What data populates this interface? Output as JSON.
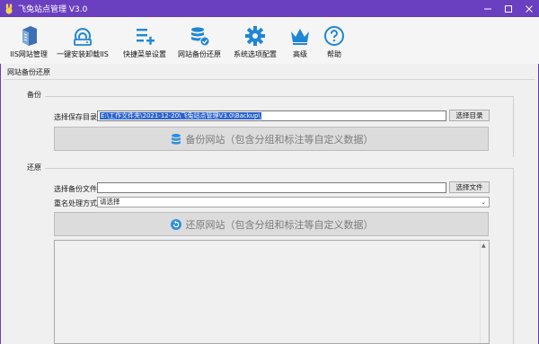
{
  "window": {
    "title": "飞兔站点管理 V3.0"
  },
  "toolbar": {
    "items": [
      {
        "label": "IIS网站管理",
        "icon": "server-icon"
      },
      {
        "label": "一键安装卸载IIS",
        "icon": "disk-drive-icon"
      },
      {
        "label": "快捷菜单设置",
        "icon": "menu-add-icon"
      },
      {
        "label": "网站备份还原",
        "icon": "database-icon"
      },
      {
        "label": "系统选项配置",
        "icon": "gear-icon"
      },
      {
        "label": "高级",
        "icon": "crown-icon"
      },
      {
        "label": "帮助",
        "icon": "help-icon"
      }
    ]
  },
  "tab": {
    "title": "网站备份还原"
  },
  "backup": {
    "group_title": "备份",
    "dir_label": "选择保存目录",
    "dir_value": "E:\\工作文件夹\\2021-12-20\\飞兔站点管理V3.0\\Backup\\",
    "choose_dir_button": "选择目录",
    "backup_button": "备份网站（包含分组和标注等自定义数据）"
  },
  "restore": {
    "group_title": "还原",
    "file_label": "选择备份文件",
    "file_value": "",
    "choose_file_button": "选择文件",
    "rename_label": "重名处理方式",
    "rename_selected": "请选择",
    "restore_button": "还原网站（包含分组和标注等自定义数据）"
  },
  "colors": {
    "titlebar": "#6a3fc0",
    "accent_blue": "#1f86d6",
    "selection": "#2a62cc"
  }
}
